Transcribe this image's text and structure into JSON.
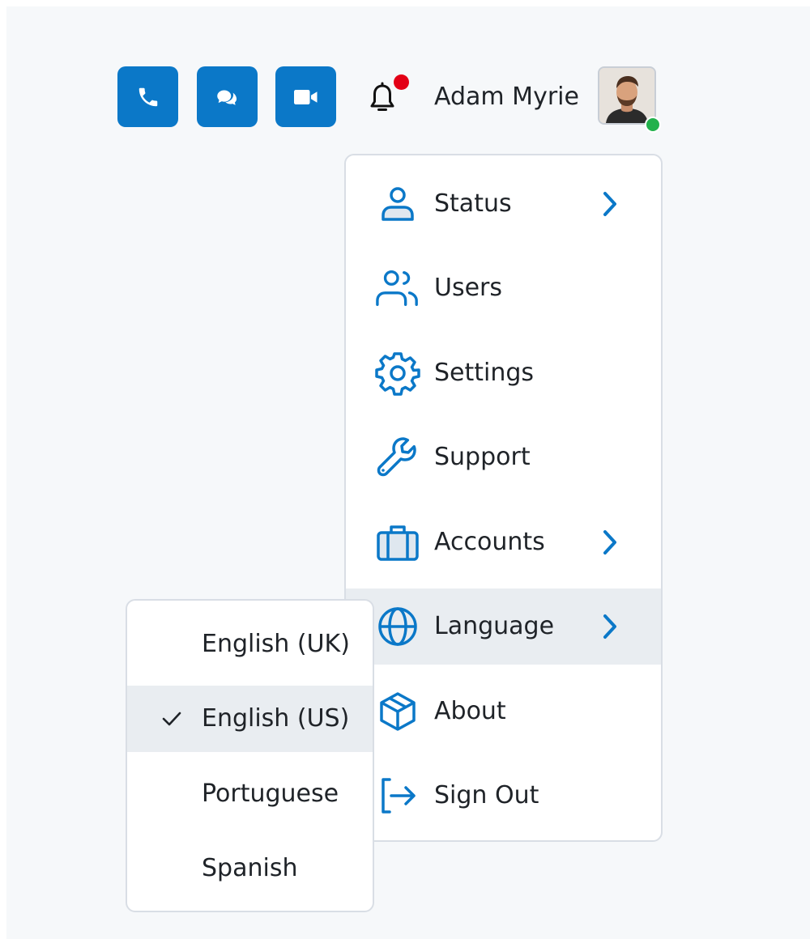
{
  "header": {
    "buttons": [
      {
        "name": "phone-button",
        "icon": "phone-icon"
      },
      {
        "name": "chat-button",
        "icon": "chat-bubbles-icon"
      },
      {
        "name": "video-button",
        "icon": "video-camera-icon"
      }
    ],
    "notifications": {
      "icon": "bell-icon",
      "has_unread": true,
      "dot_color": "#e30016"
    },
    "user": {
      "name": "Adam Myrie",
      "presence": "online",
      "presence_color": "#22b14c"
    }
  },
  "menu": {
    "items": [
      {
        "label": "Status",
        "icon": "user-icon",
        "has_submenu": true
      },
      {
        "label": "Users",
        "icon": "users-icon",
        "has_submenu": false
      },
      {
        "label": "Settings",
        "icon": "gear-icon",
        "has_submenu": false
      },
      {
        "label": "Support",
        "icon": "wrench-icon",
        "has_submenu": false
      },
      {
        "label": "Accounts",
        "icon": "briefcase-icon",
        "has_submenu": true
      },
      {
        "label": "Language",
        "icon": "globe-icon",
        "has_submenu": true,
        "active": true
      },
      {
        "label": "About",
        "icon": "box-icon",
        "has_submenu": false
      },
      {
        "label": "Sign Out",
        "icon": "sign-out-icon",
        "has_submenu": false
      }
    ]
  },
  "language_submenu": {
    "options": [
      {
        "label": "English (UK)",
        "selected": false
      },
      {
        "label": "English (US)",
        "selected": true
      },
      {
        "label": "Portuguese",
        "selected": false
      },
      {
        "label": "Spanish",
        "selected": false
      }
    ]
  },
  "colors": {
    "accent": "#0b78c8",
    "active_row": "#e9edf1",
    "border": "#d9dee5",
    "text": "#1f2328"
  }
}
